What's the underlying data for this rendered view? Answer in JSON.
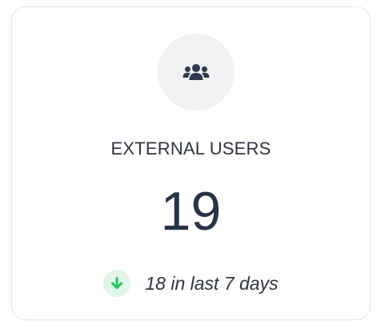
{
  "card": {
    "icon": "users-icon",
    "title": "EXTERNAL USERS",
    "value": "19",
    "trend": {
      "direction": "down",
      "icon": "arrow-down-icon",
      "text": "18 in last 7 days",
      "color": "#22c55e"
    }
  },
  "colors": {
    "text": "#2e3440",
    "value": "#283347",
    "icon_bg": "#f1f2f4",
    "trend_bg": "#e1f6e9"
  }
}
